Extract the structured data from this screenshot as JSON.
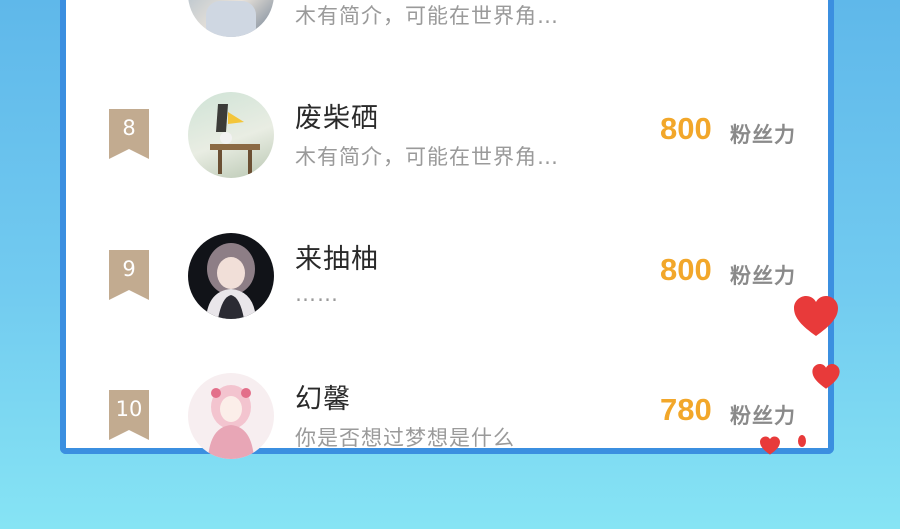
{
  "rows": [
    {
      "rank": "",
      "name": "",
      "bio": "木有简介，可能在世界角…",
      "score": "",
      "unit": ""
    },
    {
      "rank": "8",
      "name": "废柴硒",
      "bio": "木有简介，可能在世界角…",
      "score": "800",
      "unit": "粉丝力"
    },
    {
      "rank": "9",
      "name": "来抽柚",
      "bio": "……",
      "score": "800",
      "unit": "粉丝力"
    },
    {
      "rank": "10",
      "name": "幻馨",
      "bio": "你是否想过梦想是什么",
      "score": "780",
      "unit": "粉丝力"
    }
  ],
  "colors": {
    "accent_score": "#f2a72a",
    "rank_badge": "#c2ab90",
    "card_border": "#3b8fe0",
    "heart": "#e83a3a"
  },
  "icons": [
    "rank-badge-icon",
    "heart-icon"
  ]
}
